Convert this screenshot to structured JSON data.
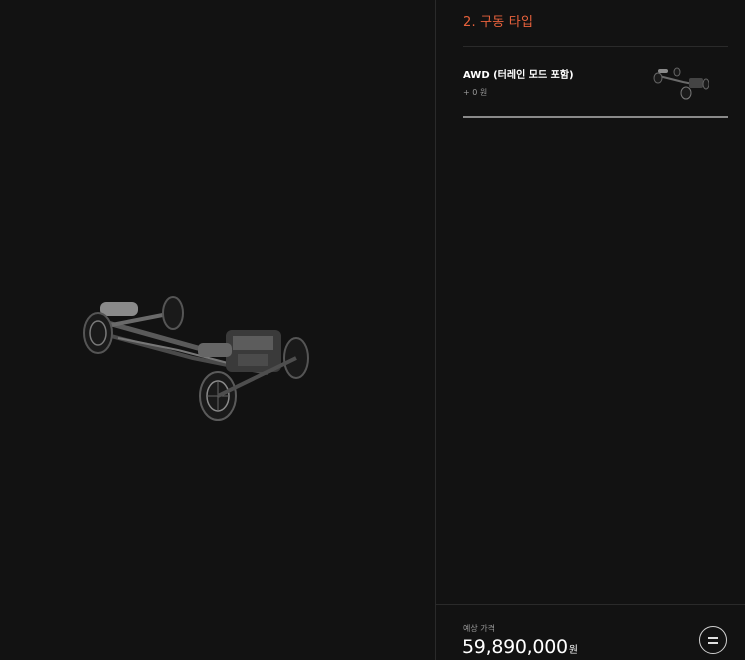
{
  "stage": {
    "image": "chassis-drivetrain-render"
  },
  "panel": {
    "section_title": "2. 구동 타입",
    "options": [
      {
        "name": "AWD (터레인 모드 포함)",
        "price": "+ 0 원",
        "thumbnail": "drivetrain-thumbnail",
        "selected": true
      }
    ]
  },
  "footer": {
    "price_label": "예상 가격",
    "price_value": "59,890,000",
    "price_unit": "원",
    "menu_icon": "menu-lines-icon"
  },
  "colors": {
    "background": "#121212",
    "accent": "#e8623c",
    "text": "#ffffff",
    "muted": "#9a9a9a",
    "selected_border": "#8a8a8a"
  }
}
